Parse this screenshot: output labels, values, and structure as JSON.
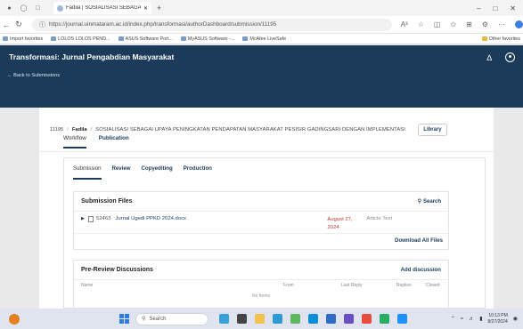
{
  "browser": {
    "tab_title": "Fadila | SOSIALISASI SEBAGAI UP...",
    "url": "https://journal.uinmataram.ac.id/index.php/transformasi/authorDashboard/submission/11195",
    "zoom_text": "A³",
    "bookmarks": [
      "Import favorites",
      "LOLOS LOLOS PEND...",
      "ASUS Software Port...",
      "MyASUS Software -...",
      "McAfee LiveSafe"
    ],
    "other_favorites": "Other favorites"
  },
  "app": {
    "title": "Transformasi: Jurnal Pengabdian Masyarakat",
    "back_link": "← Back to Submissions"
  },
  "breadcrumb": {
    "id": "11195",
    "author": "Fadila",
    "title": "SOSIALISASI SEBAGAI UPAYA PENINGKATAN PENDAPATAN MASYARAKAT PESISIR GADINGSARI DENGAN IMPLEMENTASI",
    "library_button": "Library"
  },
  "main_tabs": [
    "Workflow",
    "Publication"
  ],
  "sub_tabs": [
    "Submission",
    "Review",
    "Copyediting",
    "Production"
  ],
  "submission_files": {
    "title": "Submission Files",
    "search_label": "Search",
    "file": {
      "id": "52463",
      "name": "Jurnal Ugedi PPKD 2024.docx",
      "date": "August 27, 2024",
      "type": "Article Text"
    },
    "download_all": "Download All Files"
  },
  "discussions": {
    "title": "Pre-Review Discussions",
    "add_label": "Add discussion",
    "columns": [
      "Name",
      "From",
      "Last Reply",
      "Replies",
      "Closed"
    ],
    "no_items": "No Items"
  },
  "taskbar": {
    "search_placeholder": "Search",
    "time": "10:13 PM",
    "date": "8/27/2024"
  }
}
